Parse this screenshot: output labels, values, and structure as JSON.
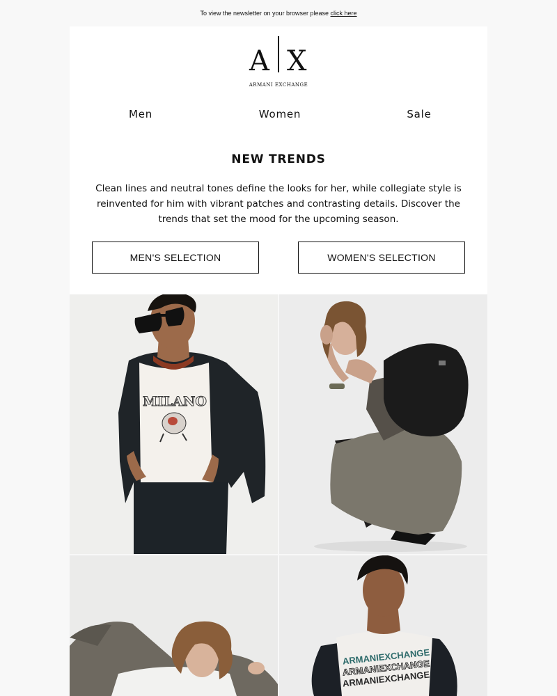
{
  "preheader": {
    "text": "To view the newsletter on your browser please",
    "link": "click here"
  },
  "brand": {
    "letter_left": "A",
    "letter_right": "X",
    "name": "ARMANI EXCHANGE"
  },
  "nav": {
    "items": [
      "Men",
      "Women",
      "Sale"
    ]
  },
  "hero": {
    "title": "NEW TRENDS",
    "body": "Clean lines and neutral tones define the looks for her, while collegiate style is reinvented for him with vibrant patches and contrasting details. Discover the trends that set the mood for the upcoming season.",
    "cta_men": "MEN'S SELECTION",
    "cta_women": "WOMEN'S SELECTION"
  },
  "photos": {
    "tee1_print": "MILANO",
    "tee2_print_lines": [
      "ARMANIEXCHANGE",
      "ARMANIEXCHANGE",
      "ARMANIEXCHANGE"
    ]
  },
  "colors": {
    "page_bg": "#f8f8f8",
    "card_bg": "#ffffff",
    "text": "#111111",
    "skin": "#b07a5a",
    "olive": "#7b776c",
    "teal_print": "#2e6b6b"
  }
}
